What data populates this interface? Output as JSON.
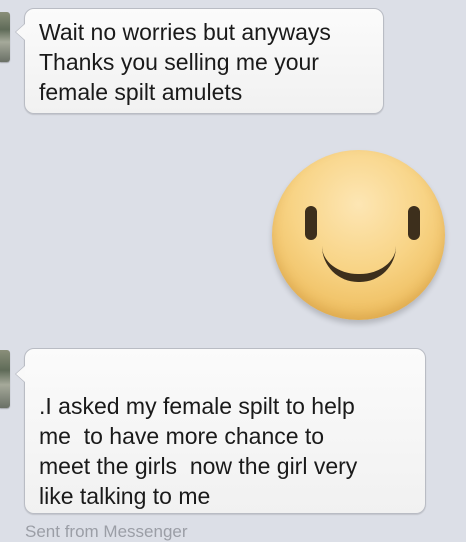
{
  "messages": [
    {
      "sender": "other",
      "lines": [
        "Wait no worries but anyways",
        "Thanks you selling me your",
        "female spilt amulets"
      ]
    },
    {
      "sender": "self",
      "sticker": "smiley-face-sticker"
    },
    {
      "sender": "other",
      "lines": [
        ".I asked my female spilt to help",
        "me  to have more chance to",
        "meet the girls  now the girl very",
        "like talking to me"
      ]
    }
  ],
  "footer": {
    "sent_from": "Sent from Messenger"
  },
  "colors": {
    "background": "#dcdfe7",
    "bubble": "#f5f5f5",
    "sticker_face": "#f8d486",
    "sticker_features": "#3d2f1c"
  }
}
